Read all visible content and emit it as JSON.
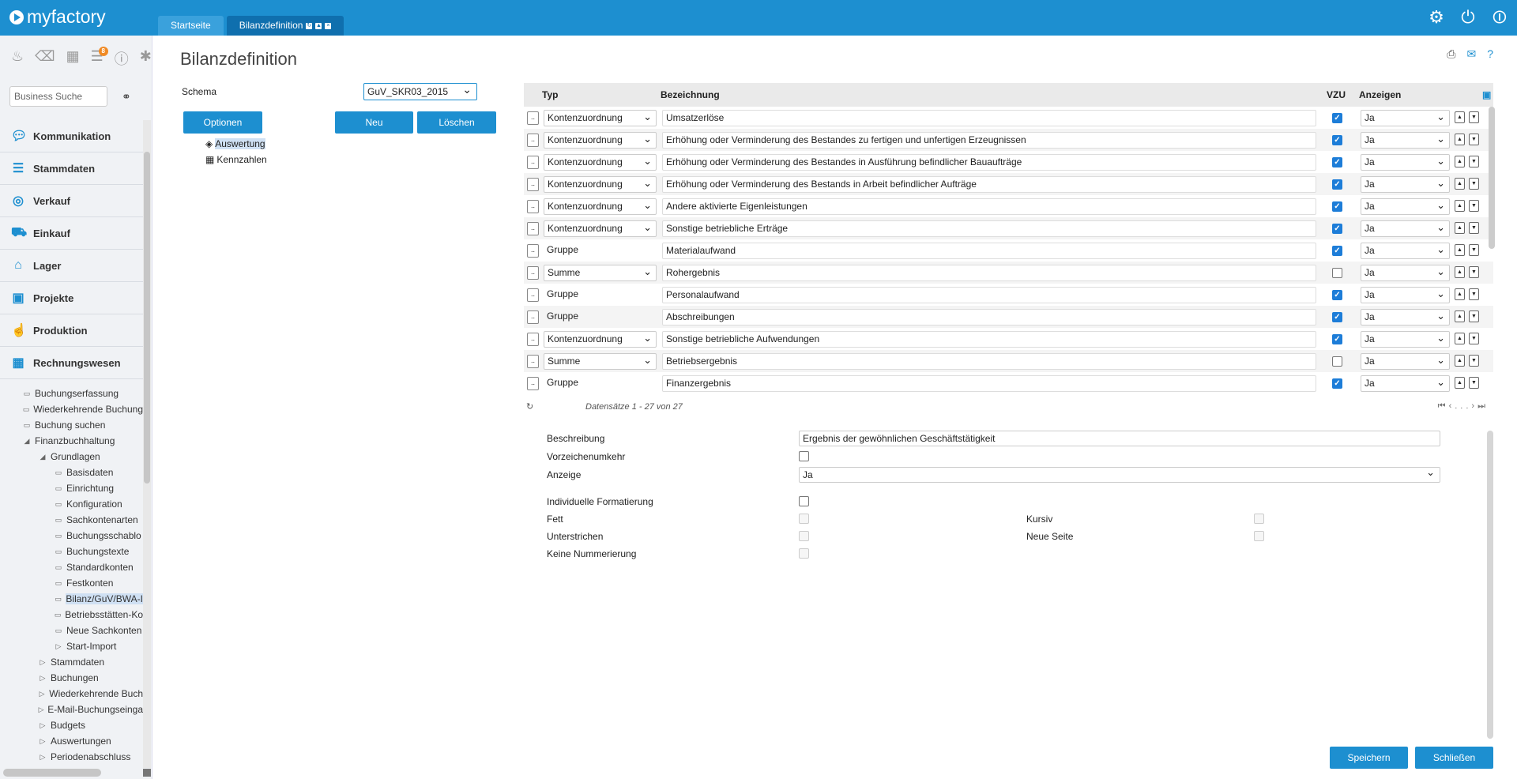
{
  "app": {
    "logo": "myfactory"
  },
  "tabs": [
    {
      "label": "Startseite"
    },
    {
      "label": "Bilanzdefinition"
    }
  ],
  "sidebar": {
    "search_placeholder": "Business Suche",
    "notification_count": "8",
    "nav": [
      {
        "label": "Kommunikation",
        "icon": "chat-icon"
      },
      {
        "label": "Stammdaten",
        "icon": "database-icon"
      },
      {
        "label": "Verkauf",
        "icon": "coins-icon"
      },
      {
        "label": "Einkauf",
        "icon": "cart-icon"
      },
      {
        "label": "Lager",
        "icon": "warehouse-icon"
      },
      {
        "label": "Projekte",
        "icon": "presentation-icon"
      },
      {
        "label": "Produktion",
        "icon": "hand-icon"
      },
      {
        "label": "Rechnungswesen",
        "icon": "grid-icon"
      }
    ],
    "tree": [
      {
        "label": "Buchungserfassung"
      },
      {
        "label": "Wiederkehrende Buchung"
      },
      {
        "label": "Buchung suchen"
      },
      {
        "label": "Finanzbuchhaltung"
      },
      {
        "label": "Grundlagen"
      },
      {
        "label": "Basisdaten"
      },
      {
        "label": "Einrichtung"
      },
      {
        "label": "Konfiguration"
      },
      {
        "label": "Sachkontenarten"
      },
      {
        "label": "Buchungsschablo"
      },
      {
        "label": "Buchungstexte"
      },
      {
        "label": "Standardkonten"
      },
      {
        "label": "Festkonten"
      },
      {
        "label": "Bilanz/GuV/BWA-I"
      },
      {
        "label": "Betriebsstätten-Ko"
      },
      {
        "label": "Neue Sachkonten"
      },
      {
        "label": "Start-Import"
      },
      {
        "label": "Stammdaten"
      },
      {
        "label": "Buchungen"
      },
      {
        "label": "Wiederkehrende Buch"
      },
      {
        "label": "E-Mail-Buchungseinga"
      },
      {
        "label": "Budgets"
      },
      {
        "label": "Auswertungen"
      },
      {
        "label": "Periodenabschluss"
      }
    ]
  },
  "main": {
    "title": "Bilanzdefinition",
    "schema_label": "Schema",
    "schema_value": "GuV_SKR03_2015",
    "options_button": "Optionen",
    "new_button": "Neu",
    "delete_button": "Löschen",
    "tree": [
      {
        "label": "Auswertung"
      },
      {
        "label": "Kennzahlen"
      }
    ]
  },
  "grid": {
    "headers": {
      "typ": "Typ",
      "bezeichnung": "Bezeichnung",
      "vzu": "VZU",
      "anzeigen": "Anzeigen"
    },
    "rows": [
      {
        "typ": "Kontenzuordnung",
        "select": true,
        "bezeichnung": "Umsatzerlöse",
        "vzu": true,
        "anzeigen": "Ja"
      },
      {
        "typ": "Kontenzuordnung",
        "select": true,
        "bezeichnung": "Erhöhung oder Verminderung des Bestandes zu fertigen und unfertigen Erzeugnissen",
        "vzu": true,
        "anzeigen": "Ja"
      },
      {
        "typ": "Kontenzuordnung",
        "select": true,
        "bezeichnung": "Erhöhung oder Verminderung des Bestandes in Ausführung befindlicher Bauaufträge",
        "vzu": true,
        "anzeigen": "Ja"
      },
      {
        "typ": "Kontenzuordnung",
        "select": true,
        "bezeichnung": "Erhöhung oder Verminderung des Bestands in Arbeit befindlicher Aufträge",
        "vzu": true,
        "anzeigen": "Ja"
      },
      {
        "typ": "Kontenzuordnung",
        "select": true,
        "bezeichnung": "Andere aktivierte Eigenleistungen",
        "vzu": true,
        "anzeigen": "Ja"
      },
      {
        "typ": "Kontenzuordnung",
        "select": true,
        "bezeichnung": "Sonstige betriebliche Erträge",
        "vzu": true,
        "anzeigen": "Ja"
      },
      {
        "typ": "Gruppe",
        "select": false,
        "bezeichnung": "Materialaufwand",
        "vzu": true,
        "anzeigen": "Ja"
      },
      {
        "typ": "Summe",
        "select": true,
        "bezeichnung": "Rohergebnis",
        "vzu": false,
        "anzeigen": "Ja"
      },
      {
        "typ": "Gruppe",
        "select": false,
        "bezeichnung": "Personalaufwand",
        "vzu": true,
        "anzeigen": "Ja"
      },
      {
        "typ": "Gruppe",
        "select": false,
        "bezeichnung": "Abschreibungen",
        "vzu": true,
        "anzeigen": "Ja"
      },
      {
        "typ": "Kontenzuordnung",
        "select": true,
        "bezeichnung": "Sonstige betriebliche Aufwendungen",
        "vzu": true,
        "anzeigen": "Ja"
      },
      {
        "typ": "Summe",
        "select": true,
        "bezeichnung": "Betriebsergebnis",
        "vzu": false,
        "anzeigen": "Ja"
      },
      {
        "typ": "Gruppe",
        "select": false,
        "bezeichnung": "Finanzergebnis",
        "vzu": true,
        "anzeigen": "Ja"
      }
    ],
    "record_count": "Datensätze 1 - 27 von 27",
    "pager_more": "..."
  },
  "form": {
    "beschreibung_label": "Beschreibung",
    "beschreibung_value": "Ergebnis der gewöhnlichen Geschäftstätigkeit",
    "vorzeichen_label": "Vorzeichenumkehr",
    "anzeige_label": "Anzeige",
    "anzeige_value": "Ja",
    "individuelle_label": "Individuelle Formatierung",
    "fett_label": "Fett",
    "kursiv_label": "Kursiv",
    "unterstrichen_label": "Unterstrichen",
    "neue_seite_label": "Neue Seite",
    "keine_nummerierung_label": "Keine Nummerierung"
  },
  "footer": {
    "save_button": "Speichern",
    "close_button": "Schließen"
  },
  "colors": {
    "brand": "#1d8fd0",
    "selected": "#cfe0f3",
    "checkbox": "#1d7dd8"
  }
}
